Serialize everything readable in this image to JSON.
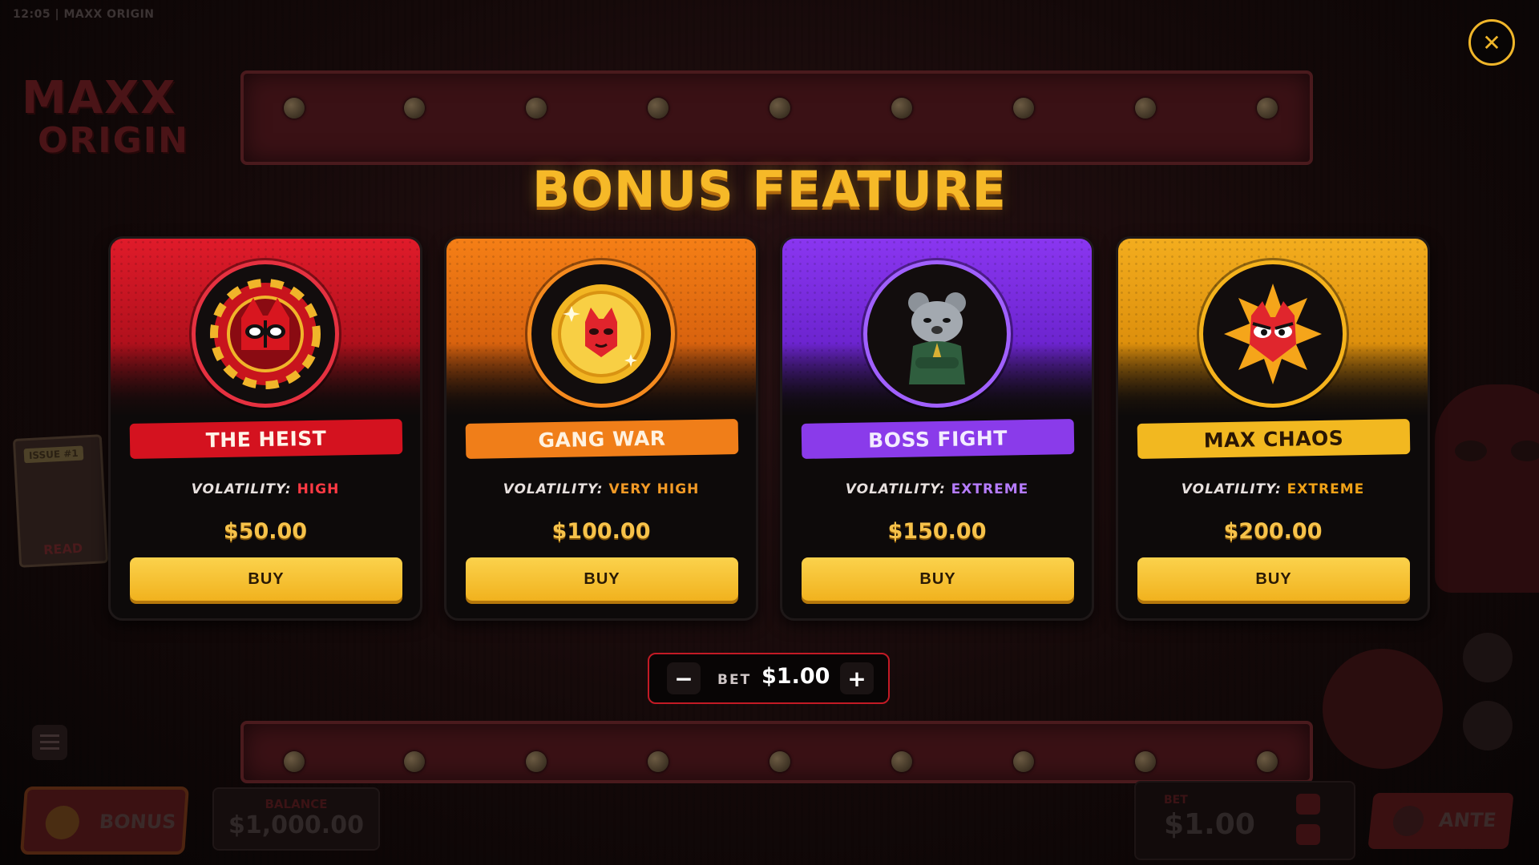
{
  "status_bar": {
    "time": "12:05",
    "separator": "|",
    "game_name": "MAXX ORIGIN"
  },
  "logo": {
    "line1": "MAXX",
    "line2": "ORIGIN"
  },
  "comic": {
    "badge": "ISSUE #1",
    "action": "READ"
  },
  "background_ui": {
    "bonus_label": "BONUS",
    "balance_label": "BALANCE",
    "balance_value": "$1,000.00",
    "bet_label": "BET",
    "bet_value": "$1.00",
    "ante_label": "ANTE"
  },
  "modal": {
    "title": "BONUS FEATURE",
    "close_icon": "close-icon",
    "volatility_label": "VOLATILITY:",
    "buy_label": "BUY",
    "cards": [
      {
        "name": "THE HEIST",
        "volatility": "HIGH",
        "price": "$50.00",
        "icon": "heist-chip-icon",
        "accent": "#e01b2a"
      },
      {
        "name": "GANG WAR",
        "volatility": "VERY HIGH",
        "price": "$100.00",
        "icon": "gold-coin-icon",
        "accent": "#f57f16"
      },
      {
        "name": "BOSS FIGHT",
        "volatility": "EXTREME",
        "price": "$150.00",
        "icon": "boss-rat-icon",
        "accent": "#8a36f0"
      },
      {
        "name": "MAX CHAOS",
        "volatility": "EXTREME",
        "price": "$200.00",
        "icon": "chaos-burst-icon",
        "accent": "#f3ad1e"
      }
    ],
    "bet": {
      "label": "BET",
      "value": "$1.00",
      "minus": "−",
      "plus": "+"
    }
  }
}
